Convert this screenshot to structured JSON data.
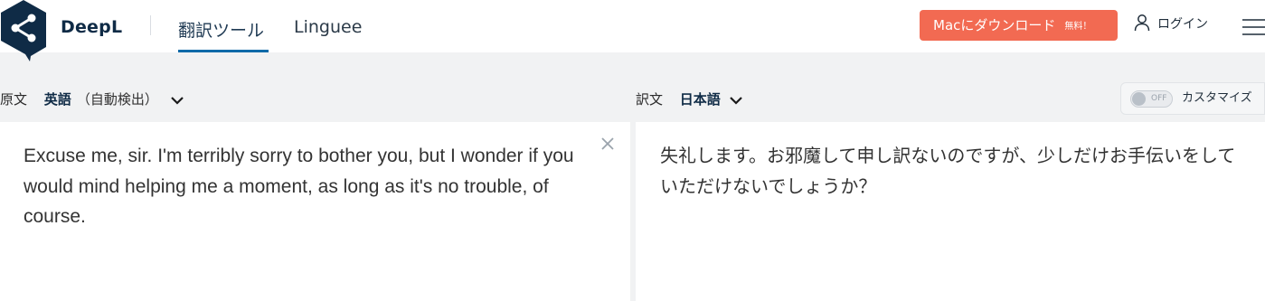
{
  "header": {
    "brand": "DeepL",
    "tabs": [
      {
        "label": "翻訳ツール",
        "active": true
      },
      {
        "label": "Linguee",
        "active": false
      }
    ],
    "download_button": {
      "label": "Macにダウンロード",
      "badge": "無料！"
    },
    "login_label": "ログイン"
  },
  "source": {
    "label": "原文",
    "language": "英語",
    "language_note": "（自動検出）",
    "text": "Excuse me, sir. I'm terribly sorry to bother you, but I wonder if you would mind helping me a moment, as long as it's no trouble, of course."
  },
  "target": {
    "label": "訳文",
    "language": "日本語",
    "text": "失礼します。お邪魔して申し訳ないのですが、少しだけお手伝いをしていただけないでしょうか？"
  },
  "customize": {
    "toggle_state": "OFF",
    "label": "カスタマイズ"
  },
  "colors": {
    "brand_navy": "#0f2b46",
    "accent_orange": "#f26a52",
    "tab_underline": "#0f6aa8",
    "background": "#f1f2f3"
  },
  "icons": {
    "logo": "deepl-share-logo",
    "login": "user-icon",
    "menu": "hamburger-menu-icon",
    "chevron": "chevron-down-icon",
    "clear": "close-icon"
  }
}
